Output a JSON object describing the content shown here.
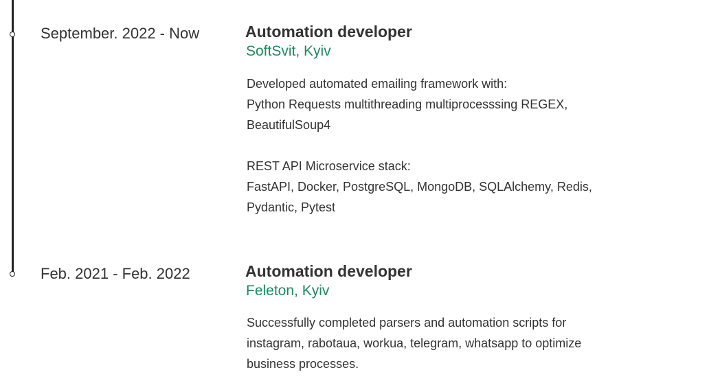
{
  "experience": [
    {
      "date": "September. 2022 - Now",
      "title": "Automation developer",
      "company": "SoftSvit, Kyiv",
      "desc_1_line_1": "Developed automated emailing framework with:",
      "desc_1_line_2": "Python Requests multithreading multiprocesssing REGEX,",
      "desc_1_line_3": "BeautifulSoup4",
      "desc_2_line_1": "REST API Microservice stack:",
      "desc_2_line_2": "FastAPI, Docker, PostgreSQL, MongoDB, SQLAlchemy, Redis,",
      "desc_2_line_3": "Pydantic, Pytest"
    },
    {
      "date": "Feb. 2021 - Feb. 2022",
      "title": "Automation developer",
      "company": "Feleton, Kyiv",
      "desc_1_line_1": "Successfully completed parsers and automation scripts for",
      "desc_1_line_2": "instagram, rabotaua, workua, telegram, whatsapp to optimize",
      "desc_1_line_3": "business processes."
    }
  ]
}
